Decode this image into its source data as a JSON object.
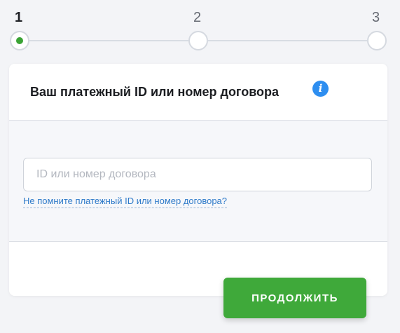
{
  "stepper": {
    "steps": [
      {
        "number": "1",
        "state": "active"
      },
      {
        "number": "2",
        "state": "inactive"
      },
      {
        "number": "3",
        "state": "inactive"
      }
    ]
  },
  "form": {
    "title": "Ваш платежный ID или номер договора",
    "info_icon": "info-icon",
    "input": {
      "value": "",
      "placeholder": "ID или номер договора"
    },
    "help_link": "Не помните платежный ID или номер договора?"
  },
  "actions": {
    "continue_label": "ПРОДОЛЖИТЬ"
  },
  "colors": {
    "accent_green": "#3fa93a",
    "info_blue": "#2e8ef0",
    "link_blue": "#2e7ac9",
    "background": "#f3f4f7"
  }
}
